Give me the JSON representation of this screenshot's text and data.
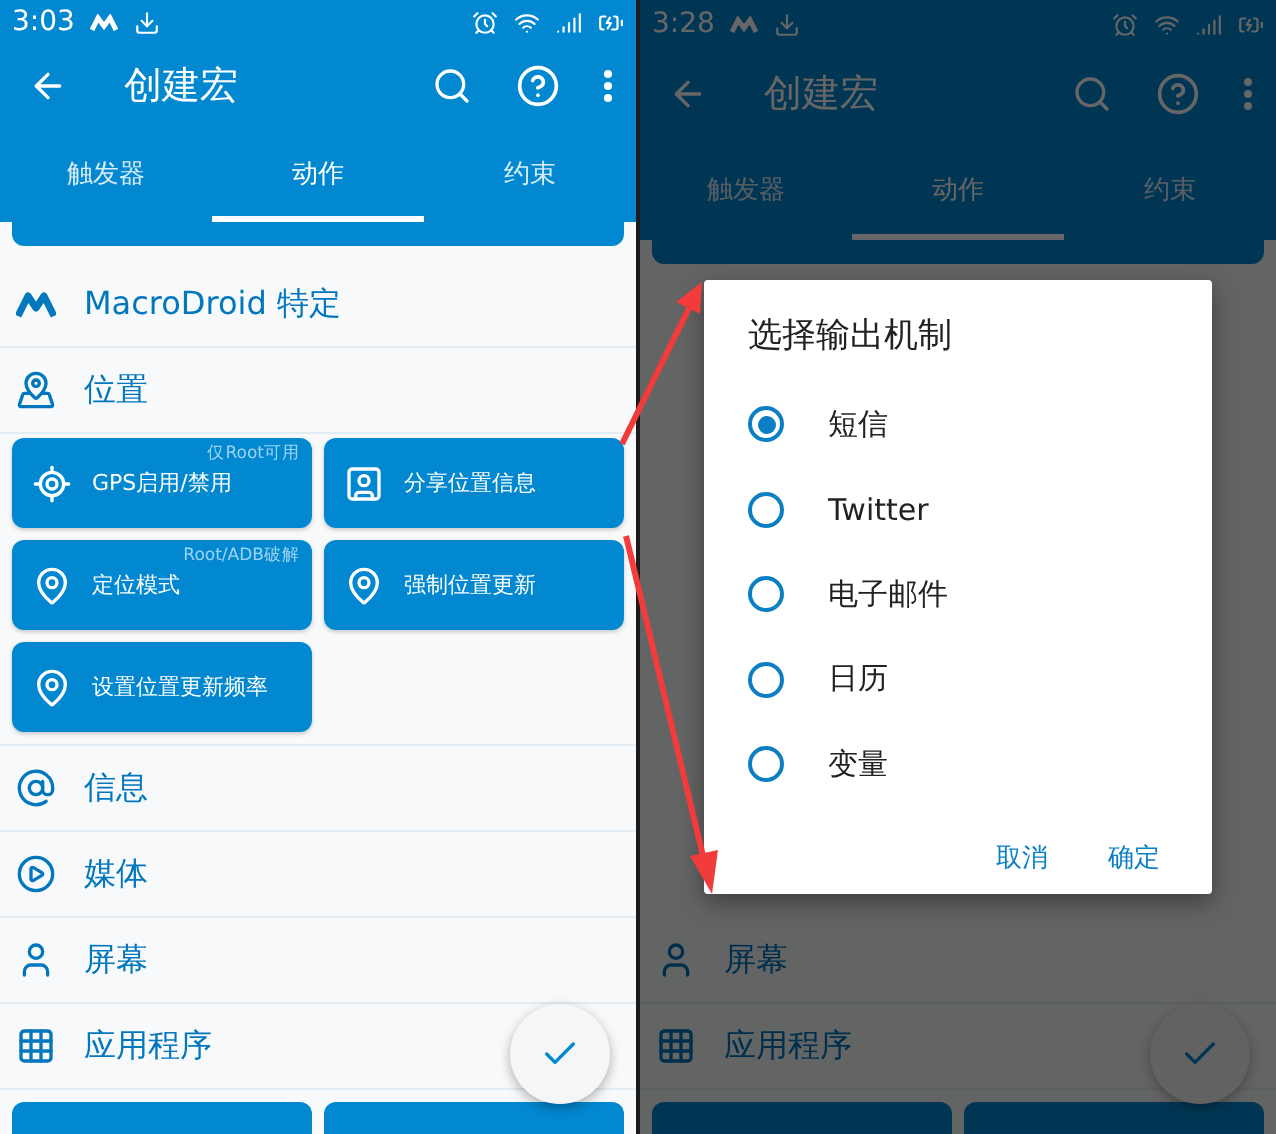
{
  "phones": [
    {
      "status_bar": {
        "time": "3:03"
      },
      "app_bar": {
        "title": "创建宏"
      },
      "tabs": [
        {
          "label": "触发器",
          "selected": false
        },
        {
          "label": "动作",
          "selected": true
        },
        {
          "label": "约束",
          "selected": false
        }
      ],
      "top": [
        {
          "kind": "card_stub"
        },
        {
          "kind": "macrodroid",
          "label": "MacroDroid 特定"
        },
        {
          "kind": "location",
          "label": "位置"
        },
        {
          "kind": "buttons",
          "items": [
            {
              "kind": "gps",
              "label": "GPS启用/禁用",
              "note": "仅Root可用"
            },
            {
              "kind": "share",
              "label": "分享位置信息"
            },
            {
              "kind": "pin",
              "label": "定位模式",
              "note": "Root/ADB破解"
            },
            {
              "kind": "pin",
              "label": "强制位置更新"
            },
            {
              "kind": "pins",
              "label": "设置位置更新频率"
            }
          ]
        },
        {
          "kind": "message",
          "label": "信息"
        },
        {
          "kind": "media",
          "label": "媒体"
        },
        {
          "kind": "screen",
          "label": "屏幕"
        },
        {
          "kind": "apps",
          "label": "应用程序"
        },
        {
          "kind": "cut_cards"
        }
      ]
    },
    {
      "status_bar": {
        "time": "3:28"
      },
      "app_bar": {
        "title": "创建宏"
      },
      "tabs": [
        {
          "label": "触发器",
          "selected": false
        },
        {
          "label": "动作",
          "selected": true
        },
        {
          "label": "约束",
          "selected": false
        }
      ],
      "top": [
        {
          "kind": "card_stub"
        }
      ],
      "bottom": [
        {
          "kind": "screen",
          "label": "屏幕"
        },
        {
          "kind": "apps",
          "label": "应用程序"
        },
        {
          "kind": "cut_cards"
        }
      ],
      "dialog": {
        "title": "选择输出机制",
        "options": [
          {
            "label": "短信",
            "selected": true
          },
          {
            "label": "Twitter",
            "selected": false
          },
          {
            "label": "电子邮件",
            "selected": false
          },
          {
            "label": "日历",
            "selected": false
          },
          {
            "label": "变量",
            "selected": false
          }
        ],
        "buttons": [
          "取消",
          "确定"
        ]
      }
    }
  ]
}
